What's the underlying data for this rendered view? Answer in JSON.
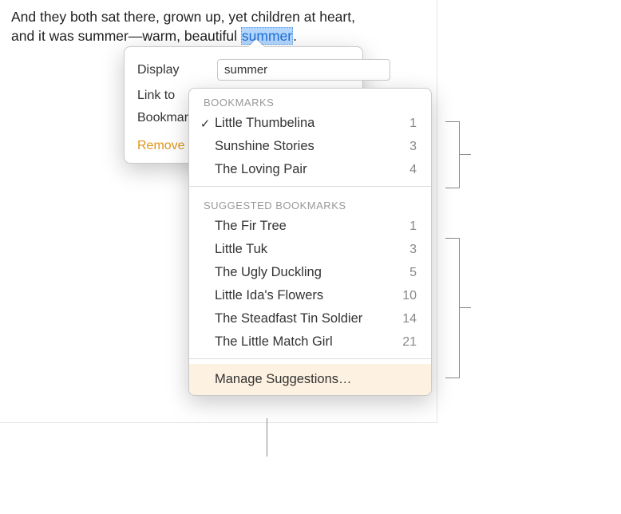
{
  "document": {
    "text_line1": "And they both sat there, grown up, yet children at heart,",
    "text_line2_pre": "and it was summer—warm, beautiful ",
    "linked_word": "summer",
    "text_line2_post": "."
  },
  "popover": {
    "display_label": "Display",
    "display_value": "summer",
    "linkto_label": "Link to",
    "bookmark_label": "Bookmark",
    "remove_label": "Remove"
  },
  "dropdown": {
    "bookmarks_header": "BOOKMARKS",
    "bookmarks": [
      {
        "label": "Little Thumbelina",
        "count": "1",
        "checked": true
      },
      {
        "label": "Sunshine Stories",
        "count": "3",
        "checked": false
      },
      {
        "label": "The Loving Pair",
        "count": "4",
        "checked": false
      }
    ],
    "suggested_header": "SUGGESTED BOOKMARKS",
    "suggested": [
      {
        "label": "The Fir Tree",
        "count": "1"
      },
      {
        "label": "Little Tuk",
        "count": "3"
      },
      {
        "label": "The Ugly Duckling",
        "count": "5"
      },
      {
        "label": "Little Ida's Flowers",
        "count": "10"
      },
      {
        "label": "The Steadfast Tin Soldier",
        "count": "14"
      },
      {
        "label": "The Little Match Girl",
        "count": "21"
      }
    ],
    "manage_label": "Manage Suggestions…"
  }
}
